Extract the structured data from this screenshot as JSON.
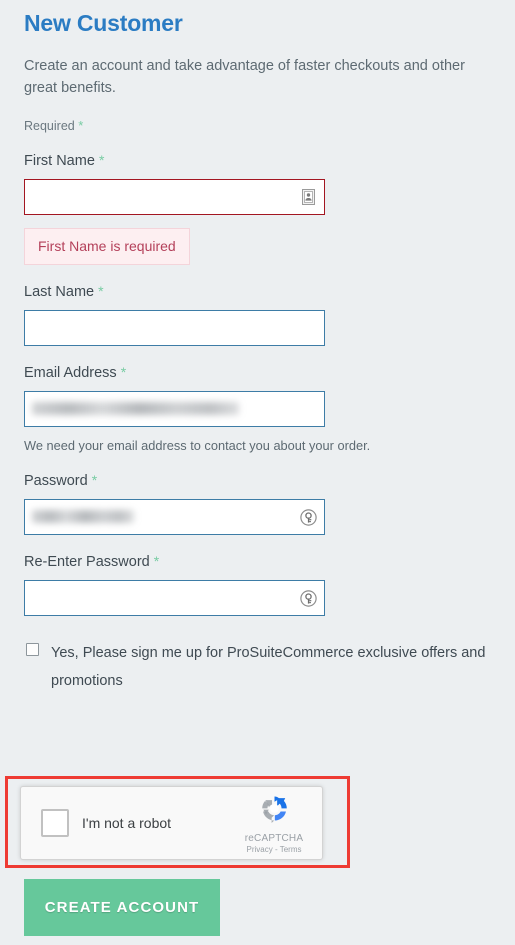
{
  "page": {
    "title": "New Customer",
    "intro": "Create an account and take advantage of faster checkouts and other great benefits.",
    "required_note": "Required",
    "required_marker": "*"
  },
  "colors": {
    "background": "#eceff1",
    "title_blue": "#2b7cc3",
    "field_border": "#3d7ca6",
    "error_border": "#a31621",
    "error_bg": "#fdeff1",
    "error_text": "#b4405a",
    "required_star_green": "#78cca3",
    "button_green": "#66c89b",
    "annotation_red": "#ee3b33"
  },
  "fields": {
    "first_name": {
      "label": "First Name",
      "value": "",
      "placeholder": "",
      "icon": "contact-card-icon",
      "error": "First Name is required",
      "state": "error"
    },
    "last_name": {
      "label": "Last Name",
      "value": "",
      "placeholder": "",
      "state": "normal"
    },
    "email": {
      "label": "Email Address",
      "value": "",
      "placeholder": "",
      "redacted": true,
      "help": "We need your email address to contact you about your order.",
      "state": "normal"
    },
    "password": {
      "label": "Password",
      "value": "",
      "placeholder": "",
      "redacted": true,
      "icon": "key-icon",
      "state": "normal"
    },
    "confirm_password": {
      "label": "Re-Enter Password",
      "value": "",
      "placeholder": "",
      "icon": "key-icon",
      "state": "normal"
    }
  },
  "newsletter": {
    "label": "Yes, Please sign me up for ProSuiteCommerce exclusive offers and promotions",
    "checked": false
  },
  "recaptcha": {
    "checkbox_label": "I'm not a robot",
    "brand": "reCAPTCHA",
    "links": "Privacy - Terms",
    "logo": "recaptcha-logo-icon",
    "checked": false
  },
  "submit": {
    "label": "Create Account"
  }
}
